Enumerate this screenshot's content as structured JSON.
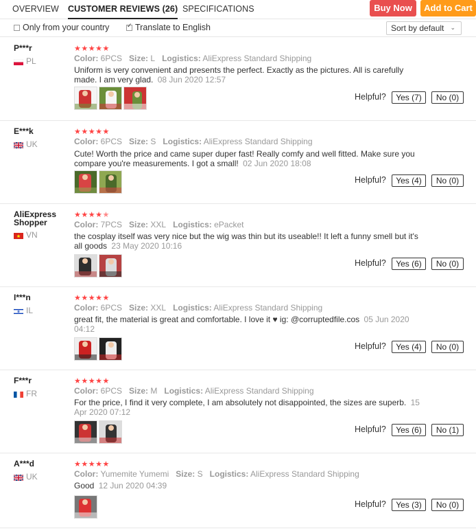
{
  "nav": {
    "tabs": [
      {
        "label": "OVERVIEW"
      },
      {
        "label": "CUSTOMER REVIEWS (26)"
      },
      {
        "label": "SPECIFICATIONS"
      }
    ],
    "buy_now": "Buy Now",
    "add_to_cart": "Add to Cart"
  },
  "filters": {
    "own_country_label": "Only from your country",
    "own_country_checked": false,
    "translate_label": "Translate to English",
    "translate_checked": true,
    "sort_value": "Sort by default"
  },
  "labels": {
    "color": "Color:",
    "size": "Size:",
    "logistics": "Logistics:",
    "helpful": "Helpful?"
  },
  "reviews": [
    {
      "user": "P***r",
      "country": "PL",
      "flag": "PL",
      "stars": "★★★★★",
      "color": "6PCS",
      "size": "L",
      "logistics": "AliExpress Standard Shipping",
      "text": "Uniform is very convenient and presents the perfect. Exactly as the pictures. All is carefully made. I am very glad.",
      "date": "08 Jun 2020 12:57",
      "yes": "Yes (7)",
      "no": "No (0)",
      "thumbs": 3
    },
    {
      "user": "E***k",
      "country": "UK",
      "flag": "UK",
      "stars": "★★★★★",
      "color": "6PCS",
      "size": "S",
      "logistics": "AliExpress Standard Shipping",
      "text": "Cute! Worth the price and came super duper fast! Really comfy and well fitted. Make sure you compare you're measurements. I got a small!",
      "date": "02 Jun 2020 18:08",
      "yes": "Yes (4)",
      "no": "No (0)",
      "thumbs": 2
    },
    {
      "user": "AliExpress Shopper",
      "country": "VN",
      "flag": "VN",
      "stars": "★★★★☆",
      "color": "7PCS",
      "size": "XXL",
      "logistics": "ePacket",
      "text": "the cosplay itself was very nice but the wig was thin but its useable!! It left a funny smell but it's all goods",
      "date": "23 May 2020 10:16",
      "yes": "Yes (6)",
      "no": "No (0)",
      "thumbs": 2
    },
    {
      "user": "I***n",
      "country": "IL",
      "flag": "IL",
      "stars": "★★★★★",
      "color": "6PCS",
      "size": "XXL",
      "logistics": "AliExpress Standard Shipping",
      "text": "great fit, the material is great and comfortable. I love it ♥ ig: @corruptedfile.cos",
      "date": "05 Jun 2020 04:12",
      "yes": "Yes (4)",
      "no": "No (0)",
      "thumbs": 2
    },
    {
      "user": "F***r",
      "country": "FR",
      "flag": "FR",
      "stars": "★★★★★",
      "color": "6PCS",
      "size": "M",
      "logistics": "AliExpress Standard Shipping",
      "text": "For the price, I find it very complete, I am absolutely not disappointed, the sizes are superb.",
      "date": "15 Apr 2020 07:12",
      "yes": "Yes (6)",
      "no": "No (1)",
      "thumbs": 2
    },
    {
      "user": "A***d",
      "country": "UK",
      "flag": "UK",
      "stars": "★★★★★",
      "color": "Yumemite Yumemi",
      "size": "S",
      "logistics": "AliExpress Standard Shipping",
      "text": "Good",
      "date": "12 Jun 2020 04:39",
      "yes": "Yes (3)",
      "no": "No (0)",
      "thumbs": 1
    }
  ]
}
